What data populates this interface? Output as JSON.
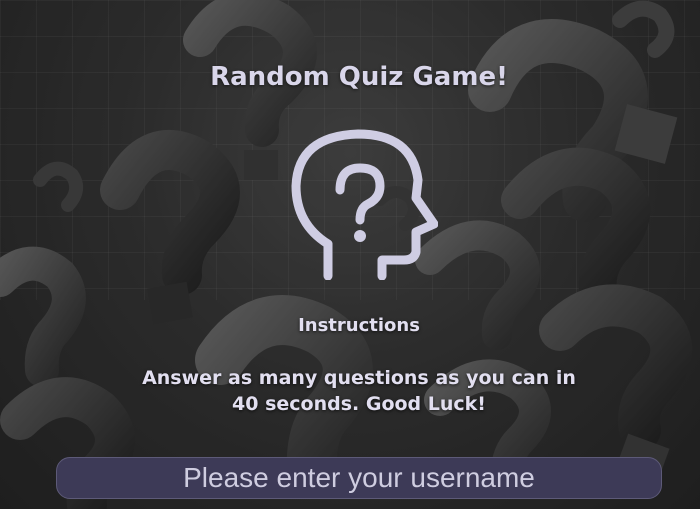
{
  "header": {
    "title": "Random Quiz Game!"
  },
  "hero": {
    "icon": "head-question-icon",
    "icon_color": "#cfcde3"
  },
  "instructions": {
    "heading": "Instructions",
    "text": "Answer as many questions as you can in 40 seconds. Good Luck!"
  },
  "login": {
    "username_placeholder": "Please enter your username",
    "username_value": ""
  },
  "colors": {
    "text": "#e2dff0",
    "input_bg": "#3d3a57"
  }
}
